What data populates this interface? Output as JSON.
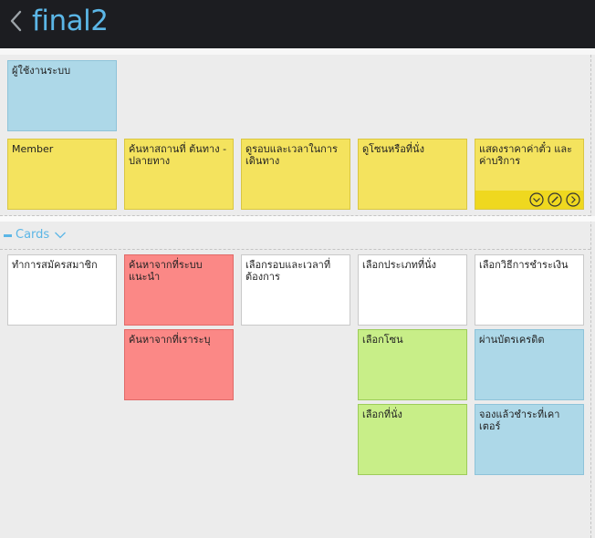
{
  "header": {
    "title": "final2"
  },
  "lane_top": {
    "role_card": "ผู้ใช้งานระบบ",
    "activities": [
      "Member",
      "ค้นหาสถานที่ ต้นทาง - ปลายทาง",
      "ดูรอบและเวลาในการเดินทาง",
      "ดูโซนหรือที่นั่ง",
      "แสดงราคาค่าตั๋ว และ ค่าบริการ"
    ]
  },
  "lane_cards": {
    "label": "Cards",
    "cards": [
      "ทำการสมัครสมาชิก",
      "ค้นหาจากที่ระบบแนะนำ",
      "ค้นหาจากที่เราระบุ",
      "เลือกรอบและเวลาที่ต้องการ",
      "เลือกประเภทที่นั่ง",
      "เลือกโซน",
      "เลือกที่นั่ง",
      "เลือกวิธีการชำระเงิน",
      "ผ่านบัตรเครดิต",
      "จองแล้วชำระที่เคาเตอร์"
    ]
  },
  "colors": {
    "accent": "#5bb6e6",
    "topbar": "#1c1d21",
    "blue_card": "#add8e8",
    "yellow_card": "#f4e35e",
    "red_card": "#fb8886",
    "green_card": "#c8ee88",
    "white_card": "#ffffff"
  },
  "icons": [
    "back-chevron-icon",
    "expand-chevron-icon",
    "down-circle-icon",
    "edit-circle-icon",
    "next-circle-icon"
  ]
}
